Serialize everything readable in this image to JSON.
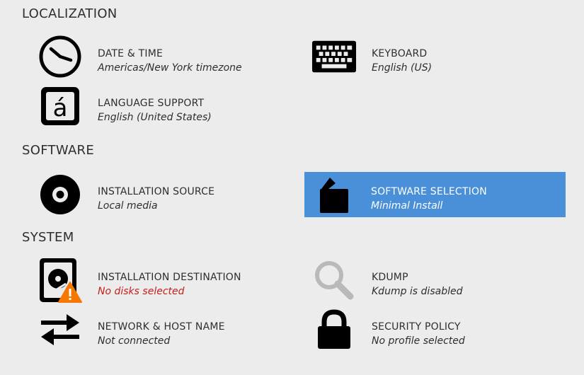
{
  "sections": {
    "localization": "LOCALIZATION",
    "software": "SOFTWARE",
    "system": "SYSTEM"
  },
  "spokes": {
    "date_time": {
      "label": "DATE & TIME",
      "status": "Americas/New York timezone",
      "icon": "clock-icon"
    },
    "keyboard": {
      "label": "KEYBOARD",
      "status": "English (US)",
      "icon": "keyboard-icon"
    },
    "language": {
      "label": "LANGUAGE SUPPORT",
      "status": "English (United States)",
      "icon": "language-icon"
    },
    "install_source": {
      "label": "INSTALLATION SOURCE",
      "status": "Local media",
      "icon": "disc-icon"
    },
    "software_selection": {
      "label": "SOFTWARE SELECTION",
      "status": "Minimal Install",
      "icon": "package-icon",
      "selected": true
    },
    "install_dest": {
      "label": "INSTALLATION DESTINATION",
      "status": "No disks selected",
      "icon": "harddisk-icon",
      "status_color": "#c4211b"
    },
    "kdump": {
      "label": "KDUMP",
      "status": "Kdump is disabled",
      "icon": "magnifier-icon"
    },
    "network": {
      "label": "NETWORK & HOST NAME",
      "status": "Not connected",
      "icon": "network-arrows-icon"
    },
    "security": {
      "label": "SECURITY POLICY",
      "status": "No profile selected",
      "icon": "lock-icon"
    }
  },
  "colors": {
    "background": "#ececec",
    "selected": "#4a90d9",
    "warning": "#c4211b",
    "warning_badge": "#f57900"
  }
}
